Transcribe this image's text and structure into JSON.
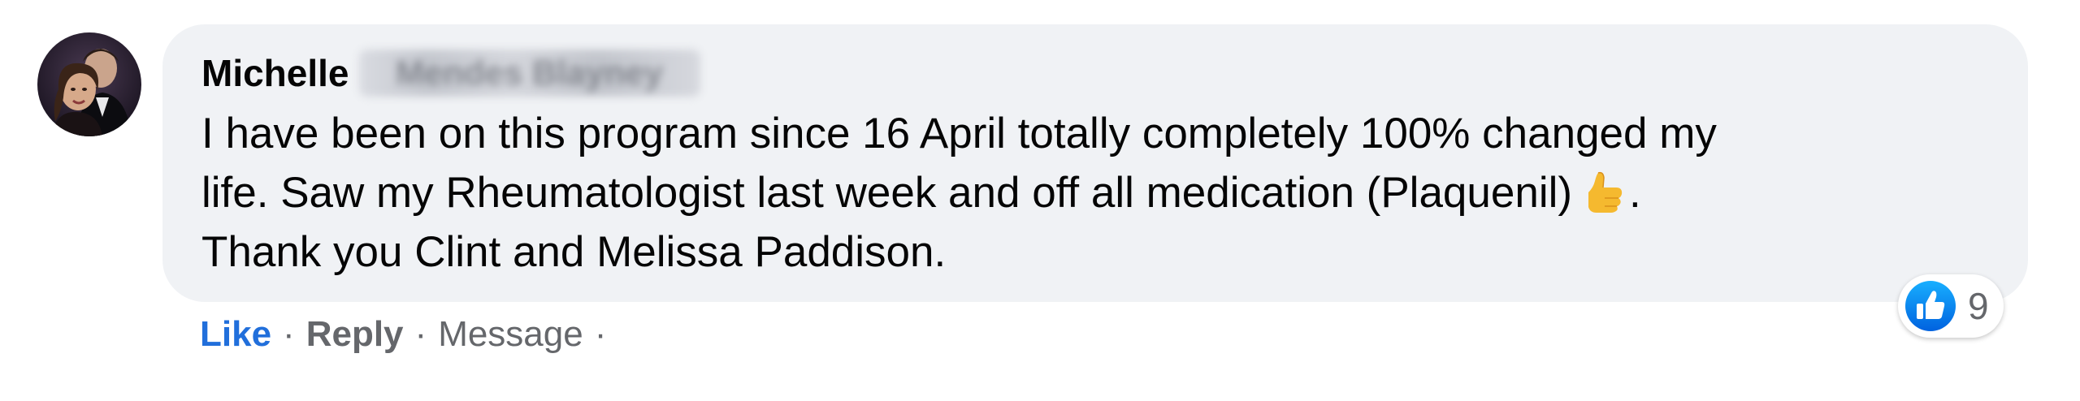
{
  "comment": {
    "author_first_name": "Michelle",
    "author_last_name_obscured": "Mendes Blayney",
    "text_lines": [
      "I have been on this program since 16 April totally completely 100% changed my",
      "life. Saw my Rheumatologist last week and off all medication (Plaquenil)",
      "Thank you Clint and Melissa Paddison."
    ],
    "line2_suffix": ".",
    "inline_emoji": "thumbs-up-icon"
  },
  "reactions": {
    "icon": "like-reaction-icon",
    "count": "9",
    "accent_color": "#1877f2"
  },
  "actions": {
    "like_label": "Like",
    "reply_label": "Reply",
    "message_label": "Message",
    "separator": "·",
    "like_color": "#216fdb"
  },
  "colors": {
    "bubble_background": "#f0f2f5",
    "text": "#050505",
    "secondary_text": "#65676b"
  }
}
